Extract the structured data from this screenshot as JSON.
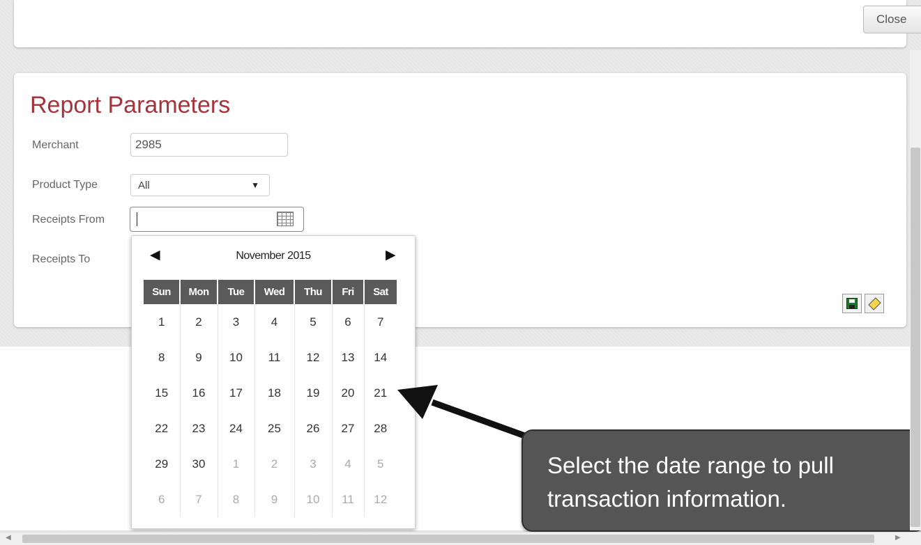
{
  "header": {
    "close_label": "Close"
  },
  "report_parameters": {
    "title": "Report Parameters",
    "merchant_label": "Merchant",
    "merchant_value": "2985",
    "product_type_label": "Product Type",
    "product_type_value": "All",
    "receipts_from_label": "Receipts From",
    "receipts_from_value": "",
    "receipts_to_label": "Receipts To"
  },
  "toolbar": {
    "save_icon": "save-icon",
    "clear_icon": "eraser-icon"
  },
  "datepicker": {
    "month_label": "November 2015",
    "prev_label": "◀",
    "next_label": "▶",
    "weekdays": [
      "Sun",
      "Mon",
      "Tue",
      "Wed",
      "Thu",
      "Fri",
      "Sat"
    ],
    "weeks": [
      [
        "1",
        "2",
        "3",
        "4",
        "5",
        "6",
        "7"
      ],
      [
        "8",
        "9",
        "10",
        "11",
        "12",
        "13",
        "14"
      ],
      [
        "15",
        "16",
        "17",
        "18",
        "19",
        "20",
        "21"
      ],
      [
        "22",
        "23",
        "24",
        "25",
        "26",
        "27",
        "28"
      ],
      [
        "29",
        "30",
        "1",
        "2",
        "3",
        "4",
        "5"
      ],
      [
        "6",
        "7",
        "8",
        "9",
        "10",
        "11",
        "12"
      ]
    ]
  },
  "callout": {
    "text": "Select the date range to pull transaction information."
  },
  "colors": {
    "title": "#a3343c",
    "calendar_header": "#5a5a5a",
    "callout_bg": "#555555"
  }
}
